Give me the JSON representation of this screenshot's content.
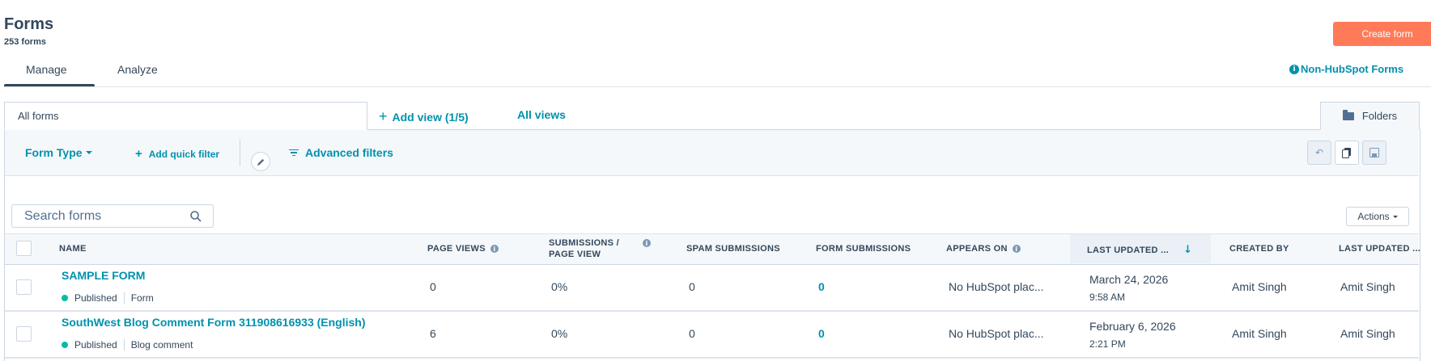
{
  "header": {
    "title": "Forms",
    "count": "253 forms",
    "create_button": "Create form",
    "non_hubspot_link": "Non-HubSpot Forms"
  },
  "tabs": [
    {
      "label": "Manage",
      "active": true
    },
    {
      "label": "Analyze",
      "active": false
    }
  ],
  "views": {
    "current": "All forms",
    "add_view": "Add view (1/5)",
    "all_views": "All views",
    "folders": "Folders"
  },
  "filters": {
    "form_type": "Form Type",
    "add_quick_filter": "Add quick filter",
    "advanced_filters": "Advanced filters"
  },
  "search": {
    "placeholder": "Search forms"
  },
  "actions_label": "Actions",
  "columns": {
    "name": "NAME",
    "page_views": "PAGE VIEWS",
    "submissions_page_view": "SUBMISSIONS / PAGE VIEW",
    "spam_submissions": "SPAM SUBMISSIONS",
    "form_submissions": "FORM SUBMISSIONS",
    "appears_on": "APPEARS ON",
    "last_updated": "LAST UPDATED ...",
    "created_by": "CREATED BY",
    "last_updated_by": "LAST UPDATED ..."
  },
  "rows": [
    {
      "name": "SAMPLE FORM",
      "status": "Published",
      "type": "Form",
      "page_views": "0",
      "submissions_page_view": "0%",
      "spam_submissions": "0",
      "form_submissions": "0",
      "appears_on": "No HubSpot plac...",
      "last_updated_date": "March 24, 2026",
      "last_updated_time": "9:58 AM",
      "created_by": "Amit Singh",
      "last_updated_by": "Amit Singh"
    },
    {
      "name": "SouthWest Blog Comment Form 311908616933 (English)",
      "status": "Published",
      "type": "Blog comment",
      "page_views": "6",
      "submissions_page_view": "0%",
      "spam_submissions": "0",
      "form_submissions": "0",
      "appears_on": "No HubSpot plac...",
      "last_updated_date": "February 6, 2026",
      "last_updated_time": "2:21 PM",
      "created_by": "Amit Singh",
      "last_updated_by": "Amit Singh"
    }
  ],
  "colors": {
    "accent": "#0091ae",
    "primary_button": "#ff7a59",
    "published_dot": "#00bda5",
    "text": "#33475b"
  }
}
